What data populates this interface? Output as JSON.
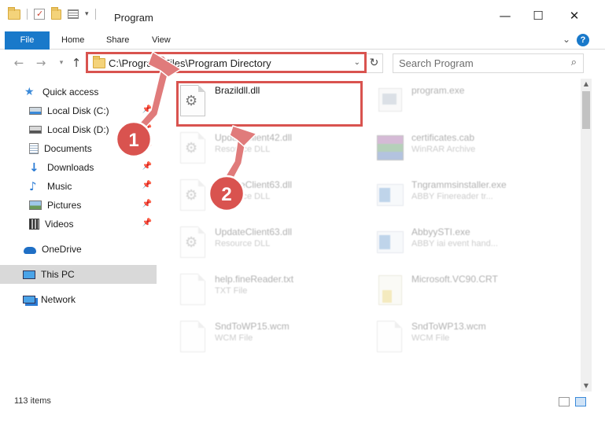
{
  "window": {
    "title": "Program",
    "minimize_glyph": "—",
    "maximize_glyph": "☐",
    "close_glyph": "✕"
  },
  "ribbon": {
    "tabs": [
      {
        "label": "File"
      },
      {
        "label": "Home"
      },
      {
        "label": "Share"
      },
      {
        "label": "View"
      }
    ],
    "help_label": "?"
  },
  "address": {
    "path": "C:\\Program Files\\Program Directory"
  },
  "search": {
    "placeholder": "Search Program"
  },
  "sidebar": {
    "items": [
      {
        "label": "Quick access",
        "icon": "star-icon"
      },
      {
        "label": "Local Disk (C:)",
        "icon": "drive-icon",
        "pinned": true
      },
      {
        "label": "Local Disk (D:)",
        "icon": "drive-icon",
        "pinned": true
      },
      {
        "label": "Documents",
        "icon": "documents-icon",
        "pinned": true
      },
      {
        "label": "Downloads",
        "icon": "download-icon",
        "pinned": true
      },
      {
        "label": "Music",
        "icon": "music-icon",
        "pinned": true
      },
      {
        "label": "Pictures",
        "icon": "pictures-icon",
        "pinned": true
      },
      {
        "label": "Videos",
        "icon": "videos-icon",
        "pinned": true
      },
      {
        "label": "OneDrive",
        "icon": "cloud-icon"
      },
      {
        "label": "This PC",
        "icon": "computer-icon",
        "selected": true
      },
      {
        "label": "Network",
        "icon": "network-icon"
      }
    ]
  },
  "files": {
    "left": [
      {
        "name": "Brazildll.dll",
        "type": "",
        "icon": "dll-icon",
        "highlighted": true
      },
      {
        "name": "UpdateClient42.dll",
        "type": "Resource DLL",
        "icon": "dll-icon"
      },
      {
        "name": "UpdateClient63.dll",
        "type": "Resource DLL",
        "icon": "dll-icon"
      },
      {
        "name": "UpdateClient63.dll",
        "type": "Resource DLL",
        "icon": "dll-icon"
      },
      {
        "name": "help.fineReader.txt",
        "type": "TXT File",
        "icon": "text-file-icon"
      },
      {
        "name": "SndToWP15.wcm",
        "type": "WCM File",
        "icon": "file-icon"
      }
    ],
    "right": [
      {
        "name": "program.exe",
        "type": "",
        "icon": "exe-icon"
      },
      {
        "name": "certificates.cab",
        "type": "WinRAR Archive",
        "icon": "archive-icon"
      },
      {
        "name": "Tngrammsinstaller.exe",
        "type": "ABBY Finereader tr...",
        "icon": "app-icon"
      },
      {
        "name": "AbbyySTI.exe",
        "type": "ABBY iai event hand...",
        "icon": "app-icon"
      },
      {
        "name": "Microsoft.VC90.CRT",
        "type": "",
        "icon": "folder-icon"
      },
      {
        "name": "SndToWP13.wcm",
        "type": "WCM File",
        "icon": "file-icon"
      }
    ]
  },
  "annotations": [
    {
      "number": "1"
    },
    {
      "number": "2"
    }
  ],
  "status": {
    "item_count": "113 items"
  },
  "colors": {
    "accent": "#1979ca",
    "highlight_box": "#d9534f",
    "arrow": "#e07b7b"
  }
}
